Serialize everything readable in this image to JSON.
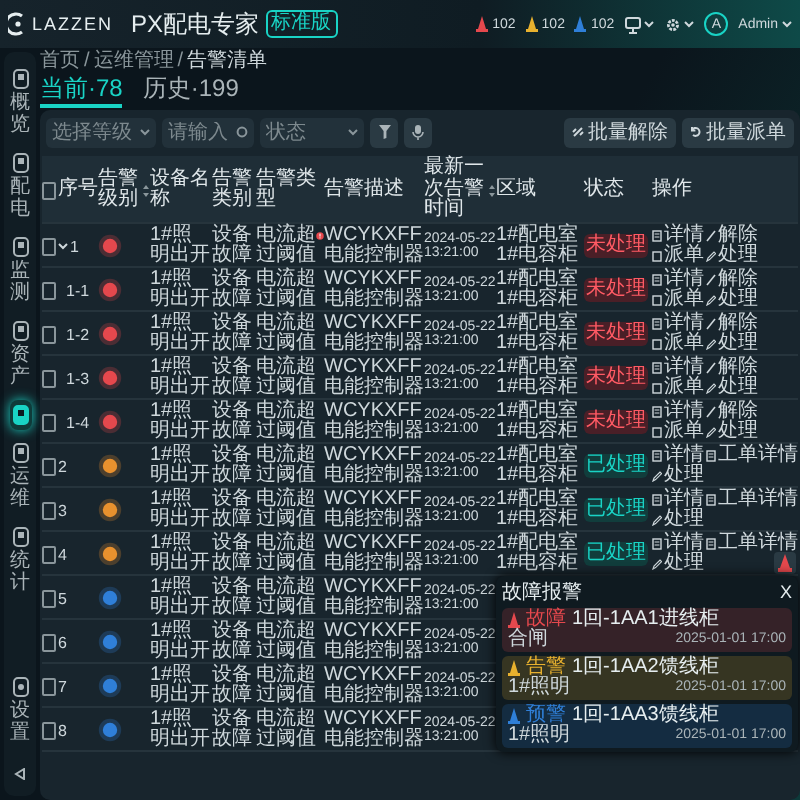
{
  "header": {
    "logo": "LAZZEN",
    "product": "PX配电专家",
    "edition": "标准版",
    "alarm_counts": [
      {
        "count": "102",
        "color": "#e5484d"
      },
      {
        "count": "102",
        "color": "#e8b12e"
      },
      {
        "count": "102",
        "color": "#2f7fd8"
      }
    ],
    "user": {
      "avatar": "A",
      "name": "Admin"
    }
  },
  "sidebar": {
    "items": [
      {
        "label": "概览",
        "selected": false
      },
      {
        "label": "配电",
        "selected": false
      },
      {
        "label": "监测",
        "selected": false
      },
      {
        "label": "资产",
        "selected": false
      },
      {
        "selected": true
      },
      {
        "label": "运维",
        "selected": false
      },
      {
        "label": "统计",
        "selected": false
      }
    ],
    "bottom_items": [
      {
        "label": "设置",
        "selected": false
      }
    ]
  },
  "breadcrumb": [
    "首页",
    "运维管理",
    "告警清单"
  ],
  "breadcrumb_separator": "/",
  "tabs": [
    {
      "label": "当前·78",
      "selected": true
    },
    {
      "label": "历史·199",
      "selected": false
    }
  ],
  "filters": {
    "level": {
      "placeholder": "选择等级"
    },
    "keyword": {
      "placeholder": "请输入"
    },
    "status": {
      "placeholder": "状态"
    }
  },
  "bulk_buttons": [
    {
      "label": "批量解除",
      "kind": "release"
    },
    {
      "label": "批量派单",
      "kind": "dispatch"
    }
  ],
  "table": {
    "header_checked": false,
    "columns": [
      {
        "label": "序号",
        "sortable": false
      },
      {
        "label": "告警级别",
        "sortable": true
      },
      {
        "label": "设备名称",
        "sortable": false
      },
      {
        "label": "告警类别",
        "sortable": false
      },
      {
        "label": "告警类型",
        "sortable": false
      },
      {
        "label": "告警描述",
        "sortable": false
      },
      {
        "label": "最新一次告警时间",
        "sortable": true
      },
      {
        "label": "区域",
        "sortable": false
      },
      {
        "label": "状态",
        "sortable": false
      },
      {
        "label": "操作",
        "sortable": false
      }
    ],
    "rows": [
      {
        "no": "1",
        "expanded": true,
        "checked": false,
        "color": "#e5484d",
        "device": "1#照明出开",
        "category": "设备故障",
        "type": "电流超过阈值",
        "flagged": true,
        "desc": "WCYKXFF电能控制器",
        "time": "2024-05-22 13:21:00",
        "area": "1#配电室1#电容柜",
        "status": "未处理",
        "handled": false,
        "actions": [
          {
            "label": "详情",
            "kind": "detail"
          },
          {
            "label": "解除",
            "kind": "release"
          },
          {
            "label": "派单",
            "kind": "dispatch"
          },
          {
            "label": "处理",
            "kind": "handle"
          }
        ],
        "children": [
          {
            "no": "1-1",
            "checked": false,
            "color": "#e5484d",
            "device": "1#照明出开",
            "category": "设备故障",
            "type": "电流超过阈值",
            "desc": "WCYKXFF电能控制器",
            "time": "2024-05-22 13:21:00",
            "area": "1#配电室1#电容柜",
            "status": "未处理",
            "handled": false,
            "actions": [
              {
                "label": "详情",
                "kind": "detail"
              },
              {
                "label": "解除",
                "kind": "release"
              },
              {
                "label": "派单",
                "kind": "dispatch"
              },
              {
                "label": "处理",
                "kind": "handle"
              }
            ]
          },
          {
            "no": "1-2",
            "checked": false,
            "color": "#e5484d",
            "device": "1#照明出开",
            "category": "设备故障",
            "type": "电流超过阈值",
            "desc": "WCYKXFF电能控制器",
            "time": "2024-05-22 13:21:00",
            "area": "1#配电室1#电容柜",
            "status": "未处理",
            "handled": false,
            "actions": [
              {
                "label": "详情",
                "kind": "detail"
              },
              {
                "label": "解除",
                "kind": "release"
              },
              {
                "label": "派单",
                "kind": "dispatch"
              },
              {
                "label": "处理",
                "kind": "handle"
              }
            ]
          },
          {
            "no": "1-3",
            "checked": false,
            "color": "#e5484d",
            "device": "1#照明出开",
            "category": "设备故障",
            "type": "电流超过阈值",
            "desc": "WCYKXFF电能控制器",
            "time": "2024-05-22 13:21:00",
            "area": "1#配电室1#电容柜",
            "status": "未处理",
            "handled": false,
            "actions": [
              {
                "label": "详情",
                "kind": "detail"
              },
              {
                "label": "解除",
                "kind": "release"
              },
              {
                "label": "派单",
                "kind": "dispatch"
              },
              {
                "label": "处理",
                "kind": "handle"
              }
            ]
          },
          {
            "no": "1-4",
            "checked": false,
            "color": "#e5484d",
            "device": "1#照明出开",
            "category": "设备故障",
            "type": "电流超过阈值",
            "desc": "WCYKXFF电能控制器",
            "time": "2024-05-22 13:21:00",
            "area": "1#配电室1#电容柜",
            "status": "未处理",
            "handled": false,
            "actions": [
              {
                "label": "详情",
                "kind": "detail"
              },
              {
                "label": "解除",
                "kind": "release"
              },
              {
                "label": "派单",
                "kind": "dispatch"
              },
              {
                "label": "处理",
                "kind": "handle"
              }
            ]
          }
        ]
      },
      {
        "no": "2",
        "checked": false,
        "color": "#e8912e",
        "device": "1#照明出开",
        "category": "设备故障",
        "type": "电流超过阈值",
        "desc": "WCYKXFF电能控制器",
        "time": "2024-05-22 13:21:00",
        "area": "1#配电室1#电容柜",
        "status": "已处理",
        "handled": true,
        "actions": [
          {
            "label": "详情",
            "kind": "detail"
          },
          {
            "label": "工单详情",
            "kind": "order"
          },
          {
            "label": "处理",
            "kind": "handle"
          }
        ]
      },
      {
        "no": "3",
        "checked": false,
        "color": "#e8912e",
        "device": "1#照明出开",
        "category": "设备故障",
        "type": "电流超过阈值",
        "desc": "WCYKXFF电能控制器",
        "time": "2024-05-22 13:21:00",
        "area": "1#配电室1#电容柜",
        "status": "已处理",
        "handled": true,
        "actions": [
          {
            "label": "详情",
            "kind": "detail"
          },
          {
            "label": "工单详情",
            "kind": "order"
          },
          {
            "label": "处理",
            "kind": "handle"
          }
        ]
      },
      {
        "no": "4",
        "checked": false,
        "color": "#e8912e",
        "device": "1#照明出开",
        "category": "设备故障",
        "type": "电流超过阈值",
        "desc": "WCYKXFF电能控制器",
        "time": "2024-05-22 13:21:00",
        "area": "1#配电室1#电容柜",
        "status": "已处理",
        "handled": true,
        "actions": [
          {
            "label": "详情",
            "kind": "detail"
          },
          {
            "label": "工单详情",
            "kind": "order"
          },
          {
            "label": "处理",
            "kind": "handle"
          }
        ]
      },
      {
        "no": "5",
        "checked": false,
        "color": "#2f7fd8",
        "device": "1#照明出开",
        "category": "设备故障",
        "type": "电流超过阈值",
        "desc": "WCYKXFF电能控制器",
        "time": "2024-05-22 13:21:00"
      },
      {
        "no": "6",
        "checked": false,
        "color": "#2f7fd8",
        "device": "1#照明出开",
        "category": "设备故障",
        "type": "电流超过阈值",
        "desc": "WCYKXFF电能控制器",
        "time": "2024-05-22 13:21:00"
      },
      {
        "no": "7",
        "checked": false,
        "color": "#2f7fd8",
        "device": "1#照明出开",
        "category": "设备故障",
        "type": "电流超过阈值",
        "desc": "WCYKXFF电能控制器",
        "time": "2024-05-22 13:21:00"
      },
      {
        "no": "8",
        "checked": false,
        "color": "#2f7fd8",
        "device": "1#照明出开",
        "category": "设备故障",
        "type": "电流超过阈值",
        "desc": "WCYKXFF电能控制器",
        "time": "2024-05-22 13:21:00"
      }
    ]
  },
  "alarm_popup": {
    "title": "故障报警",
    "close": "X",
    "items": [
      {
        "level": "故障",
        "color": "#e5484d",
        "device": "1回-1AA1进线柜",
        "detail": "合闸",
        "time": "2025-01-01 17:00"
      },
      {
        "level": "告警",
        "color": "#e8b12e",
        "device": "1回-1AA2馈线柜",
        "detail": "1#照明",
        "time": "2025-01-01 17:00"
      },
      {
        "level": "预警",
        "color": "#2f7fd8",
        "device": "1回-1AA3馈线柜",
        "detail": "1#照明",
        "time": "2025-01-01 17:00"
      }
    ]
  }
}
